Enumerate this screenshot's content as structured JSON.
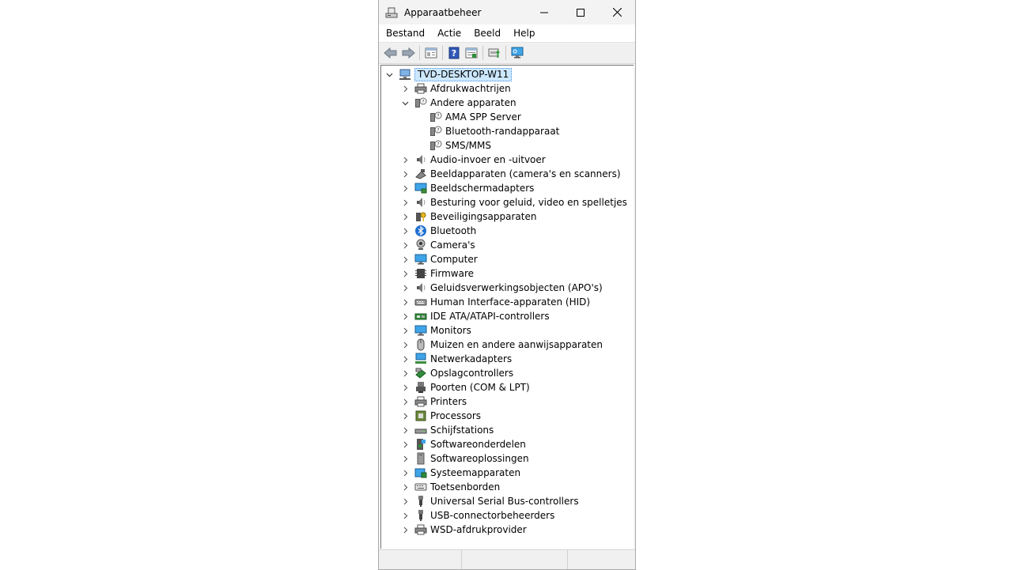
{
  "window": {
    "title": "Apparaatbeheer"
  },
  "menu": [
    "Bestand",
    "Actie",
    "Beeld",
    "Help"
  ],
  "toolbar": [
    {
      "name": "back-button",
      "icon": "arrow-left-icon"
    },
    {
      "name": "forward-button",
      "icon": "arrow-right-icon"
    },
    {
      "sep": true
    },
    {
      "name": "properties-button",
      "icon": "properties-icon"
    },
    {
      "sep": true
    },
    {
      "name": "help-button",
      "icon": "help-icon"
    },
    {
      "name": "view-button",
      "icon": "view-icon"
    },
    {
      "sep": true
    },
    {
      "name": "update-driver-button",
      "icon": "update-driver-icon"
    },
    {
      "sep": true
    },
    {
      "name": "scan-hardware-button",
      "icon": "monitor-scan-icon"
    }
  ],
  "tree": {
    "root": {
      "label": "TVD-DESKTOP-W11",
      "icon": "computer-icon",
      "expanded": true,
      "selected": true
    },
    "items": [
      {
        "label": "Afdrukwachtrijen",
        "icon": "printer-icon"
      },
      {
        "label": "Andere apparaten",
        "icon": "unknown-device-icon",
        "expanded": true,
        "children": [
          {
            "label": "AMA SPP Server",
            "icon": "unknown-device-icon"
          },
          {
            "label": "Bluetooth-randapparaat",
            "icon": "unknown-device-icon"
          },
          {
            "label": "SMS/MMS",
            "icon": "unknown-device-icon"
          }
        ]
      },
      {
        "label": "Audio-invoer en -uitvoer",
        "icon": "speaker-icon"
      },
      {
        "label": "Beeldapparaten (camera's en scanners)",
        "icon": "camera-scanner-icon"
      },
      {
        "label": "Beeldschermadapters",
        "icon": "display-adapter-icon"
      },
      {
        "label": "Besturing voor geluid, video en spelletjes",
        "icon": "speaker-icon"
      },
      {
        "label": "Beveiligingsapparaten",
        "icon": "security-key-icon"
      },
      {
        "label": "Bluetooth",
        "icon": "bluetooth-icon"
      },
      {
        "label": "Camera's",
        "icon": "webcam-icon"
      },
      {
        "label": "Computer",
        "icon": "monitor-icon"
      },
      {
        "label": "Firmware",
        "icon": "chip-icon"
      },
      {
        "label": "Geluidsverwerkingsobjecten (APO's)",
        "icon": "speaker-icon"
      },
      {
        "label": "Human Interface-apparaten (HID)",
        "icon": "hid-icon"
      },
      {
        "label": "IDE ATA/ATAPI-controllers",
        "icon": "ide-controller-icon"
      },
      {
        "label": "Monitors",
        "icon": "monitor-icon"
      },
      {
        "label": "Muizen en andere aanwijsapparaten",
        "icon": "mouse-icon"
      },
      {
        "label": "Netwerkadapters",
        "icon": "network-adapter-icon"
      },
      {
        "label": "Opslagcontrollers",
        "icon": "storage-controller-icon"
      },
      {
        "label": "Poorten (COM & LPT)",
        "icon": "port-icon"
      },
      {
        "label": "Printers",
        "icon": "printer-icon"
      },
      {
        "label": "Processors",
        "icon": "processor-icon"
      },
      {
        "label": "Schijfstations",
        "icon": "disk-drive-icon"
      },
      {
        "label": "Softwareonderdelen",
        "icon": "software-component-icon"
      },
      {
        "label": "Softwareoplossingen",
        "icon": "software-device-icon"
      },
      {
        "label": "Systeemapparaten",
        "icon": "system-folder-icon"
      },
      {
        "label": "Toetsenborden",
        "icon": "keyboard-icon"
      },
      {
        "label": "Universal Serial Bus-controllers",
        "icon": "usb-icon"
      },
      {
        "label": "USB-connectorbeheerders",
        "icon": "usb-icon"
      },
      {
        "label": "WSD-afdrukprovider",
        "icon": "printer-icon"
      }
    ]
  }
}
